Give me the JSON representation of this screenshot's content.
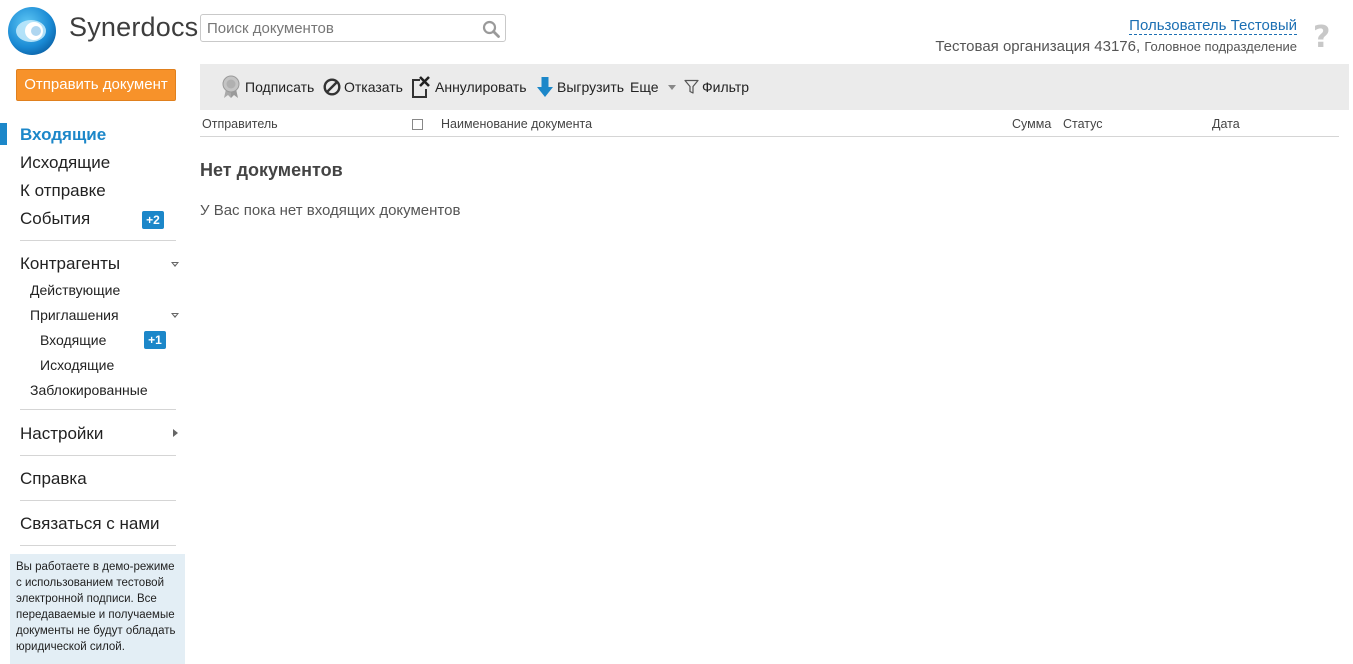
{
  "header": {
    "logo_text": "Synerdocs",
    "search_placeholder": "Поиск документов",
    "user_name": "Пользователь Тестовый",
    "org_name": "Тестовая организация 43176",
    "org_subdivision": "Головное подразделение",
    "help_symbol": "?"
  },
  "sidebar": {
    "send_button": "Отправить документ",
    "nav": {
      "incoming": "Входящие",
      "outgoing": "Исходящие",
      "to_send": "К отправке",
      "events": "События",
      "events_badge": "+2",
      "contractors": "Контрагенты",
      "active": "Действующие",
      "invitations": "Приглашения",
      "inv_incoming": "Входящие",
      "inv_incoming_badge": "+1",
      "inv_outgoing": "Исходящие",
      "blocked": "Заблокированные",
      "settings": "Настройки",
      "help": "Справка",
      "contact": "Связаться с нами"
    },
    "demo_notice": "Вы работаете в демо-режиме с использованием тестовой электронной подписи. Все передаваемые и получаемые документы не будут обладать юридической силой."
  },
  "toolbar": {
    "sign": "Подписать",
    "reject": "Отказать",
    "annul": "Аннулировать",
    "export": "Выгрузить",
    "more": "Еще",
    "filter": "Фильтр"
  },
  "table": {
    "columns": {
      "sender": "Отправитель",
      "doc_name": "Наименование документа",
      "sum": "Сумма",
      "status": "Статус",
      "date": "Дата"
    }
  },
  "empty_state": {
    "title": "Нет документов",
    "text": "У Вас пока нет входящих документов"
  },
  "colors": {
    "accent": "#1c87c9",
    "send_button": "#f7922a",
    "toolbar_bg": "#ebebeb",
    "demo_bg": "#e3eef5"
  }
}
